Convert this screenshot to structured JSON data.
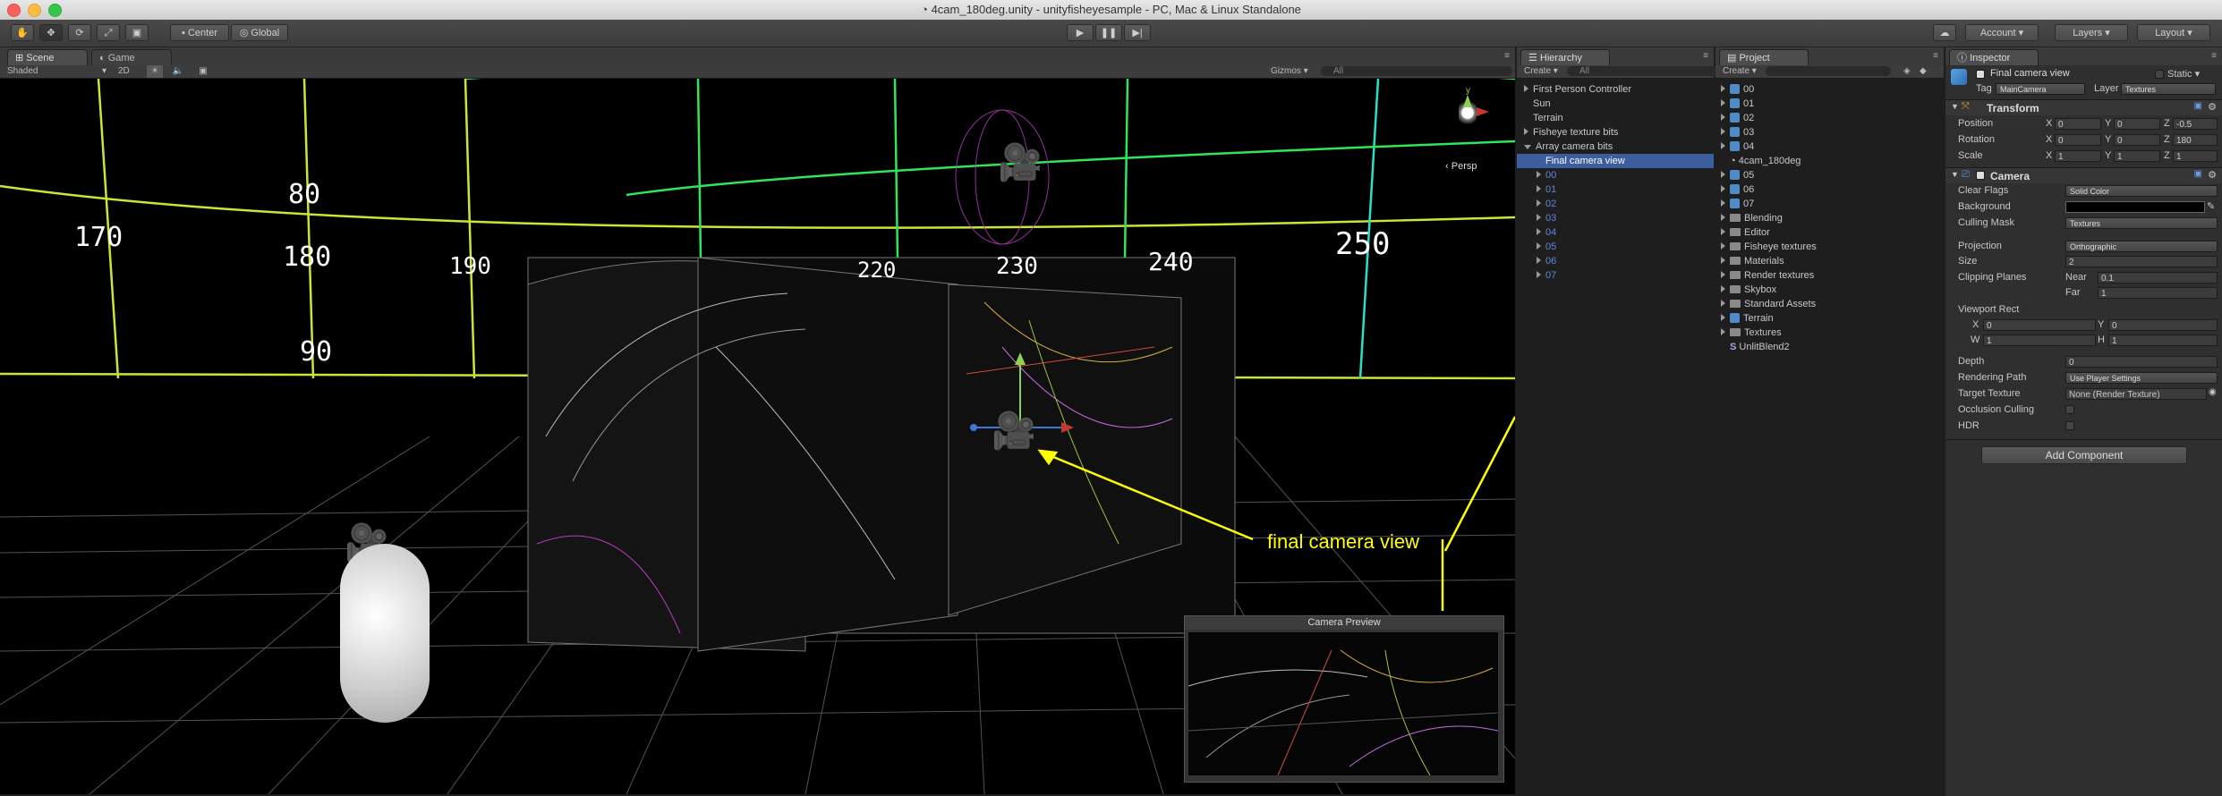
{
  "window": {
    "title": "4cam_180deg.unity - unityfisheyesample - PC, Mac & Linux Standalone"
  },
  "toolbar": {
    "pivot": "Center",
    "space": "Global",
    "account": "Account",
    "layers": "Layers",
    "layout": "Layout"
  },
  "scene_panel": {
    "tabs": [
      "Scene",
      "Game"
    ],
    "shading": "Shaded",
    "mode_2d": "2D",
    "gizmos": "Gizmos",
    "search_placeholder": "All",
    "persp": "Persp",
    "axis_y": "y"
  },
  "scene_labels": {
    "numbers": [
      "170",
      "80",
      "180",
      "90",
      "190",
      "220",
      "230",
      "240",
      "250"
    ],
    "callout": "final camera view"
  },
  "camera_preview": {
    "title": "Camera Preview"
  },
  "hierarchy": {
    "tab": "Hierarchy",
    "create": "Create",
    "search_placeholder": "All",
    "items": [
      {
        "label": "First Person Controller",
        "indent": 0,
        "arrow": "closed"
      },
      {
        "label": "Sun",
        "indent": 0,
        "arrow": "none"
      },
      {
        "label": "Terrain",
        "indent": 0,
        "arrow": "none"
      },
      {
        "label": "Fisheye texture bits",
        "indent": 0,
        "arrow": "closed"
      },
      {
        "label": "Array camera bits",
        "indent": 0,
        "arrow": "open"
      },
      {
        "label": "Final camera view",
        "indent": 1,
        "arrow": "none",
        "selected": true
      },
      {
        "label": "00",
        "indent": 1,
        "arrow": "closed",
        "blue": true
      },
      {
        "label": "01",
        "indent": 1,
        "arrow": "closed",
        "blue": true
      },
      {
        "label": "02",
        "indent": 1,
        "arrow": "closed",
        "blue": true
      },
      {
        "label": "03",
        "indent": 1,
        "arrow": "closed",
        "blue": true
      },
      {
        "label": "04",
        "indent": 1,
        "arrow": "closed",
        "blue": true
      },
      {
        "label": "05",
        "indent": 1,
        "arrow": "closed",
        "blue": true
      },
      {
        "label": "06",
        "indent": 1,
        "arrow": "closed",
        "blue": true
      },
      {
        "label": "07",
        "indent": 1,
        "arrow": "closed",
        "blue": true
      }
    ]
  },
  "project": {
    "tab": "Project",
    "create": "Create",
    "items": [
      {
        "label": "00",
        "icon": "prefab"
      },
      {
        "label": "01",
        "icon": "prefab"
      },
      {
        "label": "02",
        "icon": "prefab"
      },
      {
        "label": "03",
        "icon": "prefab"
      },
      {
        "label": "04",
        "icon": "prefab"
      },
      {
        "label": "4cam_180deg",
        "icon": "scene"
      },
      {
        "label": "05",
        "icon": "prefab"
      },
      {
        "label": "06",
        "icon": "prefab"
      },
      {
        "label": "07",
        "icon": "prefab"
      },
      {
        "label": "Blending",
        "icon": "folder"
      },
      {
        "label": "Editor",
        "icon": "folder"
      },
      {
        "label": "Fisheye textures",
        "icon": "folder"
      },
      {
        "label": "Materials",
        "icon": "folder"
      },
      {
        "label": "Render textures",
        "icon": "folder"
      },
      {
        "label": "Skybox",
        "icon": "folder"
      },
      {
        "label": "Standard Assets",
        "icon": "folder"
      },
      {
        "label": "Terrain",
        "icon": "prefab"
      },
      {
        "label": "Textures",
        "icon": "folder"
      },
      {
        "label": "UnlitBlend2",
        "icon": "shader"
      }
    ]
  },
  "inspector": {
    "tab": "Inspector",
    "object_name": "Final camera view",
    "static": "Static",
    "tag_label": "Tag",
    "tag": "MainCamera",
    "layer_label": "Layer",
    "layer": "Textures",
    "transform": {
      "title": "Transform",
      "position_label": "Position",
      "rotation_label": "Rotation",
      "scale_label": "Scale",
      "position": {
        "x": "0",
        "y": "0",
        "z": "-0.5"
      },
      "rotation": {
        "x": "0",
        "y": "0",
        "z": "180"
      },
      "scale": {
        "x": "1",
        "y": "1",
        "z": "1"
      }
    },
    "camera": {
      "title": "Camera",
      "clear_flags_label": "Clear Flags",
      "clear_flags": "Solid Color",
      "background_label": "Background",
      "culling_mask_label": "Culling Mask",
      "culling_mask": "Textures",
      "projection_label": "Projection",
      "projection": "Orthographic",
      "size_label": "Size",
      "size": "2",
      "clipping_label": "Clipping Planes",
      "near_label": "Near",
      "near": "0.1",
      "far_label": "Far",
      "far": "1",
      "viewport_label": "Viewport Rect",
      "vx": "0",
      "vy": "0",
      "vw": "1",
      "vh": "1",
      "depth_label": "Depth",
      "depth": "0",
      "rendering_path_label": "Rendering Path",
      "rendering_path": "Use Player Settings",
      "target_texture_label": "Target Texture",
      "target_texture": "None (Render Texture)",
      "occlusion_label": "Occlusion Culling",
      "hdr_label": "HDR"
    },
    "add_component": "Add Component"
  },
  "axis_letters": {
    "x": "X",
    "y": "Y",
    "z": "Z",
    "w": "W",
    "h": "H"
  },
  "colors": {
    "grid_yellow": "#c8e632",
    "grid_green": "#2ee65a",
    "grid_cyan": "#27e0c8",
    "selection": "#3d5e9e",
    "callout": "#ffff00"
  }
}
